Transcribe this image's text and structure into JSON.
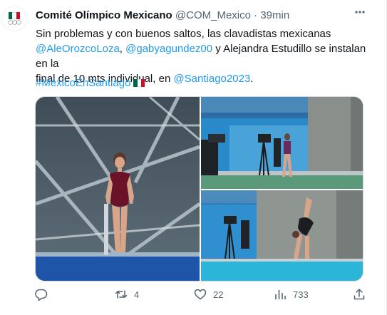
{
  "account": {
    "name": "Comité Olímpico Mexicano",
    "handle": "@COM_Mexico",
    "separator": "·",
    "time": "39min",
    "avatar_rings": "◯◯◯"
  },
  "tweet": {
    "line1": "Sin problemas y con buenos saltos, las clavadistas mexicanas",
    "mention1": "@AleOrozcoLoza",
    "comma1": ", ",
    "mention2": "@gabyagundez00",
    "line2_rest": " y Alejandra Estudillo se instalan en la",
    "line3_start": "final de 10 mts individual, en ",
    "mention3": "@Santiago2023",
    "line3_end": ".",
    "hashtag": "#MéxicoEnSantiago"
  },
  "metrics": {
    "replies": "",
    "retweets": "4",
    "likes": "22",
    "views": "733"
  },
  "icons": [
    "more-icon",
    "reply-icon",
    "retweet-icon",
    "like-icon",
    "views-icon",
    "share-icon"
  ],
  "colors": {
    "link": "#1d9bf0",
    "secondary_text": "#536471",
    "mexico_green": "#006847",
    "mexico_red": "#ce1126"
  }
}
